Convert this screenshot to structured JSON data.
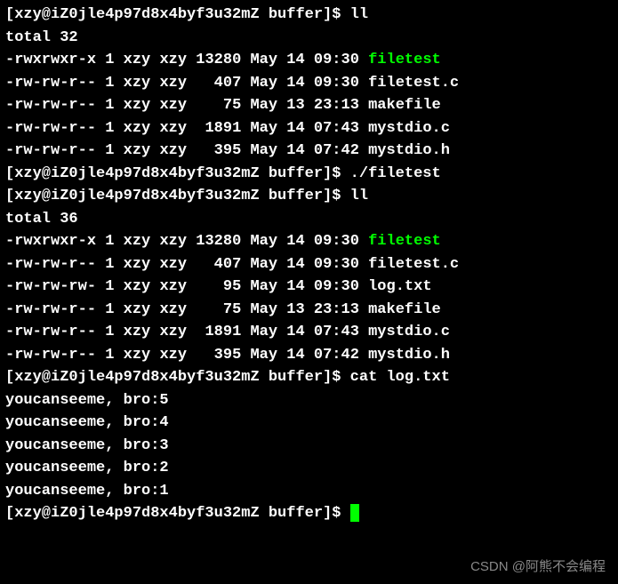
{
  "prompt": "[xzy@iZ0jle4p97d8x4byf3u32mZ buffer]$ ",
  "commands": {
    "ll1": "ll",
    "run_filetest": "./filetest",
    "ll2": "ll",
    "cat": "cat log.txt"
  },
  "listing1": {
    "total": "total 32",
    "rows": [
      {
        "perm": "-rwxrwxr-x",
        "cnt": "1",
        "own": "xzy",
        "grp": "xzy",
        "sz": "13280",
        "dt": "May 14 09:30",
        "fn": "filetest",
        "exec": true
      },
      {
        "perm": "-rw-rw-r--",
        "cnt": "1",
        "own": "xzy",
        "grp": "xzy",
        "sz": "  407",
        "dt": "May 14 09:30",
        "fn": "filetest.c",
        "exec": false
      },
      {
        "perm": "-rw-rw-r--",
        "cnt": "1",
        "own": "xzy",
        "grp": "xzy",
        "sz": "   75",
        "dt": "May 13 23:13",
        "fn": "makefile",
        "exec": false
      },
      {
        "perm": "-rw-rw-r--",
        "cnt": "1",
        "own": "xzy",
        "grp": "xzy",
        "sz": " 1891",
        "dt": "May 14 07:43",
        "fn": "mystdio.c",
        "exec": false
      },
      {
        "perm": "-rw-rw-r--",
        "cnt": "1",
        "own": "xzy",
        "grp": "xzy",
        "sz": "  395",
        "dt": "May 14 07:42",
        "fn": "mystdio.h",
        "exec": false
      }
    ]
  },
  "listing2": {
    "total": "total 36",
    "rows": [
      {
        "perm": "-rwxrwxr-x",
        "cnt": "1",
        "own": "xzy",
        "grp": "xzy",
        "sz": "13280",
        "dt": "May 14 09:30",
        "fn": "filetest",
        "exec": true
      },
      {
        "perm": "-rw-rw-r--",
        "cnt": "1",
        "own": "xzy",
        "grp": "xzy",
        "sz": "  407",
        "dt": "May 14 09:30",
        "fn": "filetest.c",
        "exec": false
      },
      {
        "perm": "-rw-rw-rw-",
        "cnt": "1",
        "own": "xzy",
        "grp": "xzy",
        "sz": "   95",
        "dt": "May 14 09:30",
        "fn": "log.txt",
        "exec": false
      },
      {
        "perm": "-rw-rw-r--",
        "cnt": "1",
        "own": "xzy",
        "grp": "xzy",
        "sz": "   75",
        "dt": "May 13 23:13",
        "fn": "makefile",
        "exec": false
      },
      {
        "perm": "-rw-rw-r--",
        "cnt": "1",
        "own": "xzy",
        "grp": "xzy",
        "sz": " 1891",
        "dt": "May 14 07:43",
        "fn": "mystdio.c",
        "exec": false
      },
      {
        "perm": "-rw-rw-r--",
        "cnt": "1",
        "own": "xzy",
        "grp": "xzy",
        "sz": "  395",
        "dt": "May 14 07:42",
        "fn": "mystdio.h",
        "exec": false
      }
    ]
  },
  "cat_output": [
    "youcanseeme, bro:5",
    "youcanseeme, bro:4",
    "youcanseeme, bro:3",
    "youcanseeme, bro:2",
    "youcanseeme, bro:1"
  ],
  "watermark": "CSDN @阿熊不会编程"
}
